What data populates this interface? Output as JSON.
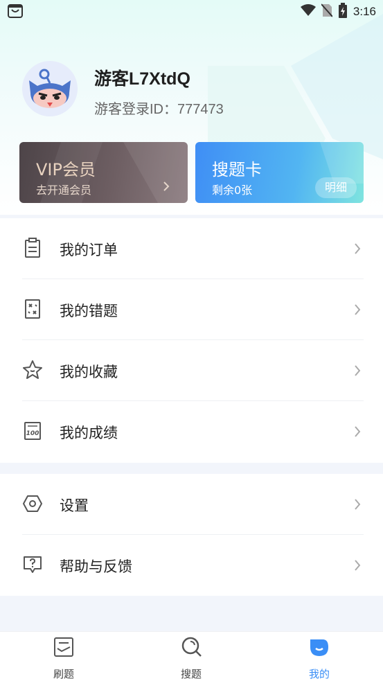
{
  "status_bar": {
    "time": "3:16",
    "icons": [
      "app-notification-icon",
      "wifi-icon",
      "no-sim-icon",
      "battery-charging-icon"
    ]
  },
  "profile": {
    "username": "游客L7XtdQ",
    "user_id": "游客登录ID：777473",
    "avatar_icon": "cartoon-avatar-icon"
  },
  "cards": {
    "vip": {
      "title": "VIP会员",
      "subtitle": "去开通会员"
    },
    "search_card": {
      "title": "搜题卡",
      "subtitle": "剩余0张",
      "detail_button": "明细"
    }
  },
  "menu_primary": [
    {
      "label": "我的订单",
      "icon": "clipboard-icon"
    },
    {
      "label": "我的错题",
      "icon": "wrong-answers-icon"
    },
    {
      "label": "我的收藏",
      "icon": "star-icon"
    },
    {
      "label": "我的成绩",
      "icon": "score-100-icon"
    }
  ],
  "menu_secondary": [
    {
      "label": "设置",
      "icon": "hexagon-settings-icon"
    },
    {
      "label": "帮助与反馈",
      "icon": "help-feedback-icon"
    }
  ],
  "tabbar": [
    {
      "label": "刷题",
      "icon": "practice-icon",
      "active": false
    },
    {
      "label": "搜题",
      "icon": "search-icon",
      "active": false
    },
    {
      "label": "我的",
      "icon": "profile-icon",
      "active": true
    }
  ],
  "colors": {
    "accent": "#3a8ef6",
    "vip_card": "#5a4e52",
    "search_card_start": "#3f8ef5",
    "search_card_end": "#7fe4df",
    "background": "#f2f5fb"
  }
}
